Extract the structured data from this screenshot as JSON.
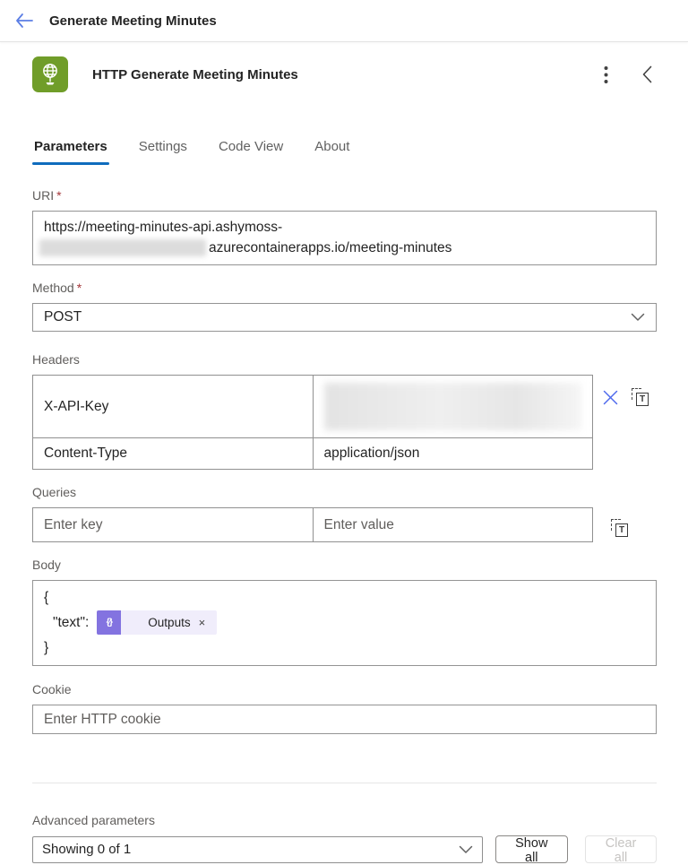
{
  "topbar": {
    "title": "Generate Meeting Minutes",
    "back_icon": "back-arrow-icon"
  },
  "action_header": {
    "title": "HTTP Generate Meeting Minutes",
    "icon": "http-globe-icon",
    "menu_icon": "kebab-menu-icon",
    "collapse_icon": "chevron-left-icon"
  },
  "tabs": [
    {
      "label": "Parameters",
      "active": true
    },
    {
      "label": "Settings",
      "active": false
    },
    {
      "label": "Code View",
      "active": false
    },
    {
      "label": "About",
      "active": false
    }
  ],
  "fields": {
    "uri": {
      "label": "URI",
      "required_mark": "*",
      "value_line1": "https://meeting-minutes-api.ashymoss-",
      "value_line2_redacted": true,
      "value_line2": "azurecontainerapps.io/meeting-minutes"
    },
    "method": {
      "label": "Method",
      "required_mark": "*",
      "value": "POST"
    },
    "headers": {
      "label": "Headers",
      "rows": [
        {
          "key": "X-API-Key",
          "value_redacted": true,
          "value": ""
        },
        {
          "key": "Content-Type",
          "value": "application/json"
        }
      ],
      "delete_icon": "delete-x-icon",
      "text_mode_icon": "switch-to-text-mode-icon"
    },
    "queries": {
      "label": "Queries",
      "key_placeholder": "Enter key",
      "value_placeholder": "Enter value",
      "text_mode_icon": "switch-to-text-mode-icon"
    },
    "body": {
      "label": "Body",
      "line_open": "{",
      "key": "\"text\":",
      "token_label": "Outputs",
      "token_icon": "expression-token-icon",
      "token_remove": "×",
      "line_close": "}"
    },
    "cookie": {
      "label": "Cookie",
      "placeholder": "Enter HTTP cookie"
    }
  },
  "advanced": {
    "label": "Advanced parameters",
    "dropdown_value": "Showing 0 of 1",
    "show_all_label": "Show all",
    "clear_all_label": "Clear all",
    "clear_all_disabled": true
  },
  "colors": {
    "tab_accent_blue": "#0f6cbd",
    "back_arrow_blue": "#5b7ee5",
    "action_icon_green": "#709d29",
    "token_purple": "#8373e0",
    "token_bg_lavender": "#f0edfb",
    "delete_x_blue": "#4f6bed",
    "required_red": "#a4373a",
    "label_gray": "#605e5c"
  }
}
